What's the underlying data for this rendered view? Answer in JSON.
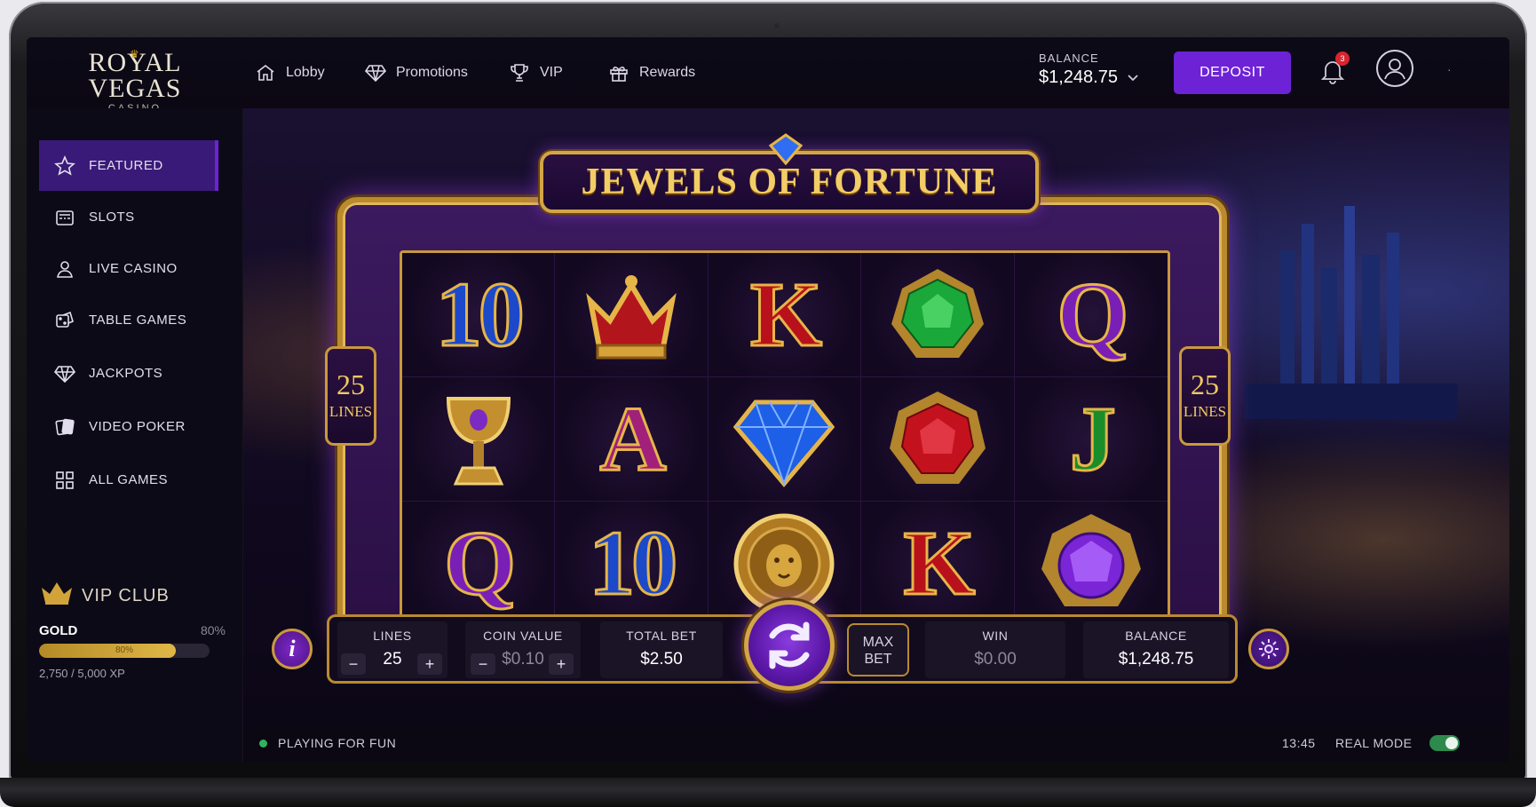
{
  "brand": {
    "line1": "ROYAL",
    "line2": "VEGAS",
    "line3": "CASINO"
  },
  "nav": [
    {
      "label": "Lobby",
      "icon": "home-icon"
    },
    {
      "label": "Promotions",
      "icon": "diamond-icon"
    },
    {
      "label": "VIP",
      "icon": "trophy-icon"
    },
    {
      "label": "Rewards",
      "icon": "gift-icon"
    }
  ],
  "header": {
    "balance_label": "BALANCE",
    "balance_value": "$1,248.75",
    "deposit_label": "DEPOSIT",
    "notification_count": "3"
  },
  "sidebar": {
    "items": [
      {
        "label": "FEATURED",
        "icon": "star-icon",
        "active": true
      },
      {
        "label": "SLOTS",
        "icon": "slot-machine-icon"
      },
      {
        "label": "LIVE CASINO",
        "icon": "dealer-icon"
      },
      {
        "label": "TABLE GAMES",
        "icon": "dice-icon"
      },
      {
        "label": "JACKPOTS",
        "icon": "diamond-icon"
      },
      {
        "label": "VIDEO POKER",
        "icon": "cards-icon"
      },
      {
        "label": "ALL GAMES",
        "icon": "grid-icon"
      }
    ],
    "vip": {
      "title": "VIP CLUB",
      "tier": "GOLD",
      "percent_label": "80%",
      "progress": 0.8,
      "bar_label": "80%",
      "xp": "2,750 / 5,000 XP"
    }
  },
  "game": {
    "title": "JEWELS OF FORTUNE",
    "lines_left": {
      "number": "25",
      "text": "LINES"
    },
    "lines_right": {
      "number": "25",
      "text": "LINES"
    },
    "reels": [
      [
        "10",
        "crown",
        "K",
        "green-gem",
        "Q"
      ],
      [
        "chalice",
        "A",
        "blue-diamond",
        "red-gem",
        "J"
      ],
      [
        "Q",
        "10",
        "lion-coin",
        "K",
        "purple-gem"
      ]
    ],
    "controls": {
      "lines_label": "LINES",
      "lines_value": "25",
      "coin_label": "COIN VALUE",
      "coin_value": "$0.10",
      "total_bet_label": "TOTAL BET",
      "total_bet_value": "$2.50",
      "max_bet_line1": "MAX",
      "max_bet_line2": "BET",
      "win_label": "WIN",
      "win_value": "$0.00",
      "balance_label": "BALANCE",
      "balance_value": "$1,248.75",
      "minus": "−",
      "plus": "+",
      "info": "i"
    }
  },
  "status": {
    "playing": "PLAYING FOR FUN",
    "time": "13:45",
    "mode": "REAL MODE",
    "mode_on": true
  },
  "colors": {
    "accent": "#6d22d6",
    "gold": "#d3a546",
    "live": "#2fb35c"
  }
}
